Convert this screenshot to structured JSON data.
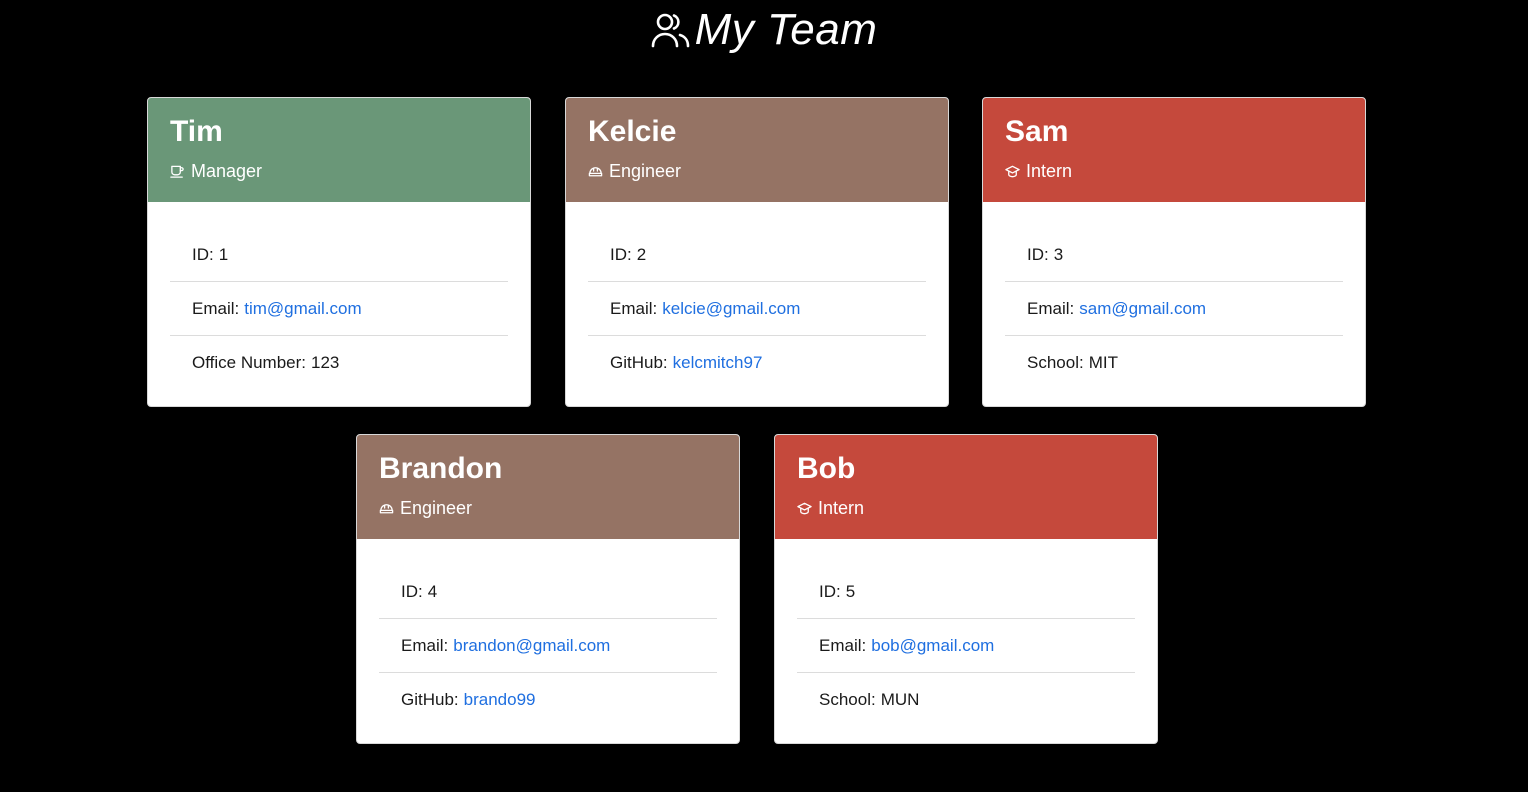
{
  "page": {
    "title": "My Team",
    "icon": "people-icon"
  },
  "colors": {
    "manager": "#6a9778",
    "engineer": "#957364",
    "intern": "#c5493c",
    "link": "#1f6fe0"
  },
  "cards": [
    {
      "name": "Tim",
      "role": "Manager",
      "role_icon": "coffee-mug-icon",
      "rows": [
        {
          "label": "ID:",
          "value": "1"
        },
        {
          "label": "Email:",
          "value": "tim@gmail.com"
        },
        {
          "label": "Office Number:",
          "value": "123"
        }
      ]
    },
    {
      "name": "Kelcie",
      "role": "Engineer",
      "role_icon": "hard-hat-icon",
      "rows": [
        {
          "label": "ID:",
          "value": "2"
        },
        {
          "label": "Email:",
          "value": "kelcie@gmail.com"
        },
        {
          "label": "GitHub:",
          "value": "kelcmitch97"
        }
      ]
    },
    {
      "name": "Sam",
      "role": "Intern",
      "role_icon": "graduation-cap-icon",
      "rows": [
        {
          "label": "ID:",
          "value": "3"
        },
        {
          "label": "Email:",
          "value": "sam@gmail.com"
        },
        {
          "label": "School:",
          "value": "MIT"
        }
      ]
    },
    {
      "name": "Brandon",
      "role": "Engineer",
      "role_icon": "hard-hat-icon",
      "rows": [
        {
          "label": "ID:",
          "value": "4"
        },
        {
          "label": "Email:",
          "value": "brandon@gmail.com"
        },
        {
          "label": "GitHub:",
          "value": "brando99"
        }
      ]
    },
    {
      "name": "Bob",
      "role": "Intern",
      "role_icon": "graduation-cap-icon",
      "rows": [
        {
          "label": "ID:",
          "value": "5"
        },
        {
          "label": "Email:",
          "value": "bob@gmail.com"
        },
        {
          "label": "School:",
          "value": "MUN"
        }
      ]
    }
  ]
}
